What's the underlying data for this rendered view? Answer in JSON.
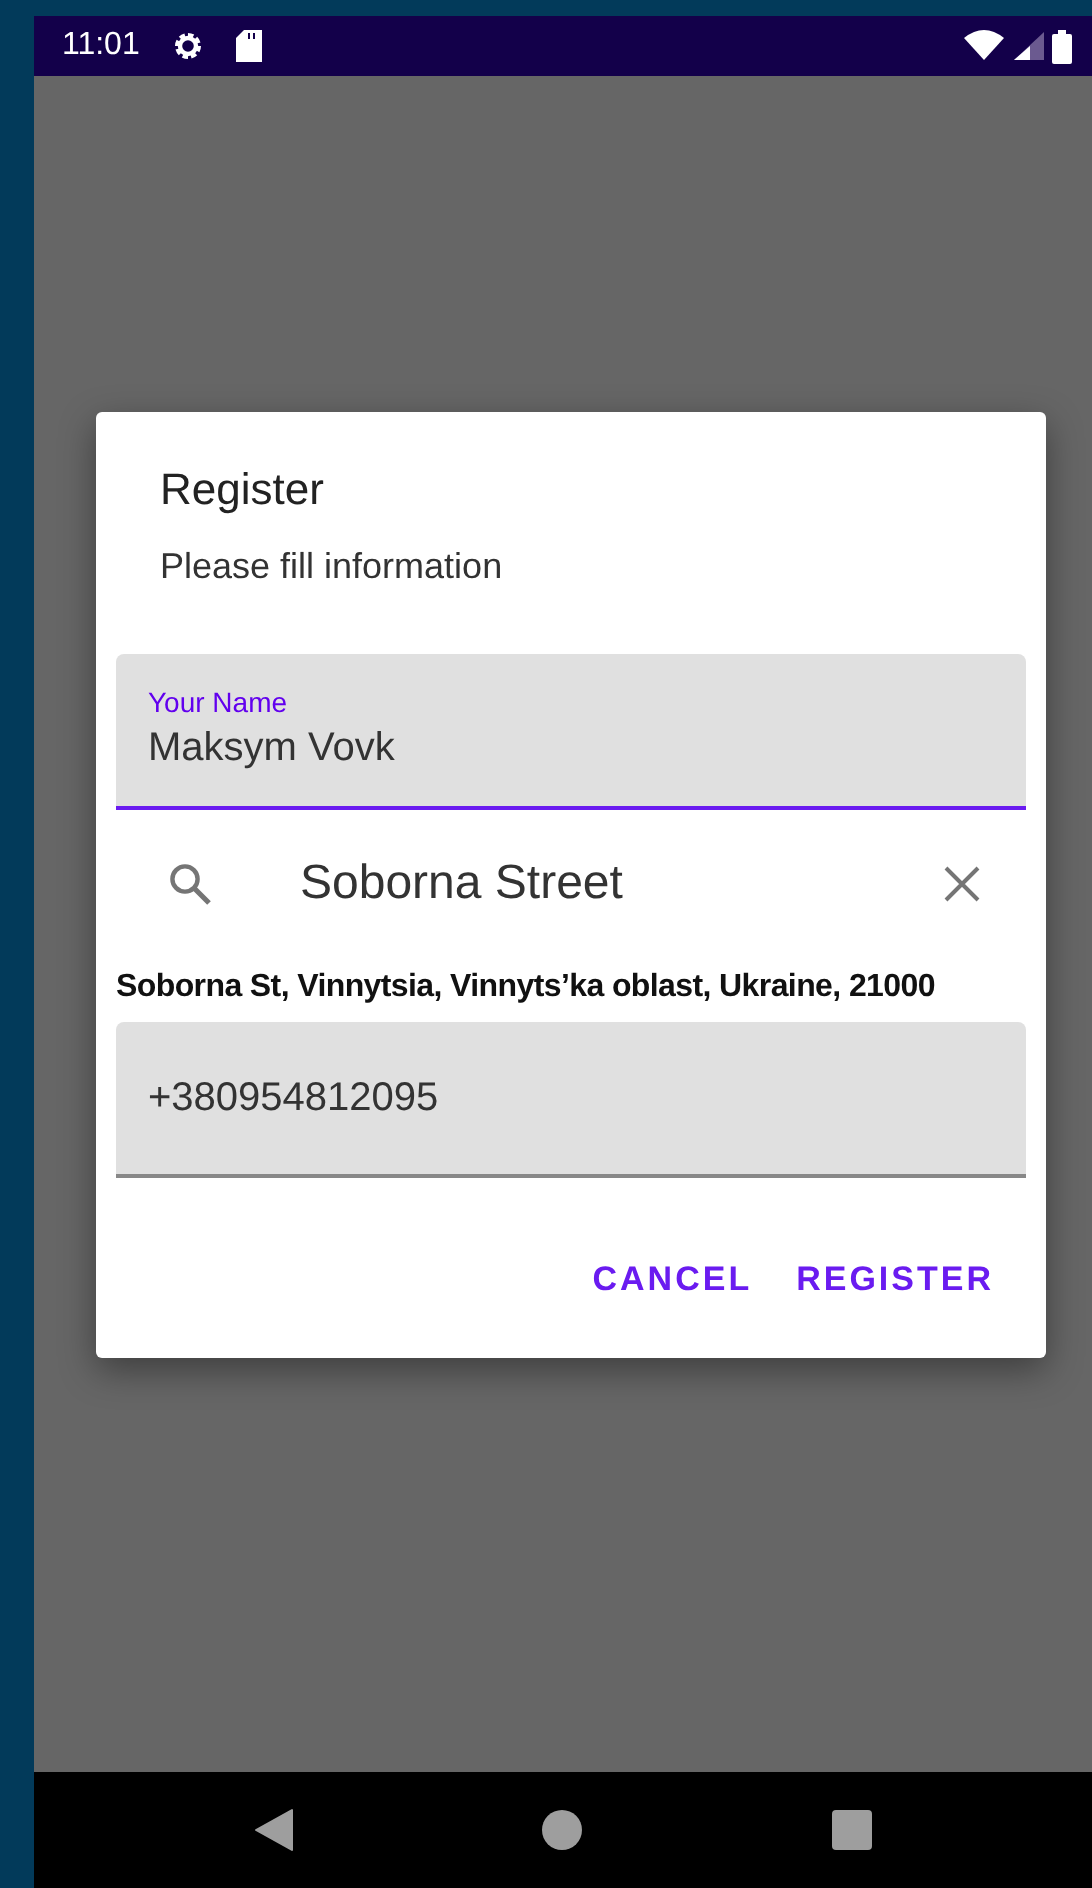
{
  "status_bar": {
    "time": "11:01"
  },
  "dialog": {
    "title": "Register",
    "message": "Please fill information",
    "name_field": {
      "label": "Your Name",
      "value": "Maksym Vovk",
      "focused": true
    },
    "search": {
      "value": "Soborna Street"
    },
    "address": "Soborna St, Vinnytsia, Vinnyts’ka oblast, Ukraine, 21000",
    "phone_field": {
      "value": "+380954812095",
      "focused": false
    },
    "buttons": [
      {
        "label": "CANCEL"
      },
      {
        "label": "REGISTER"
      }
    ]
  }
}
